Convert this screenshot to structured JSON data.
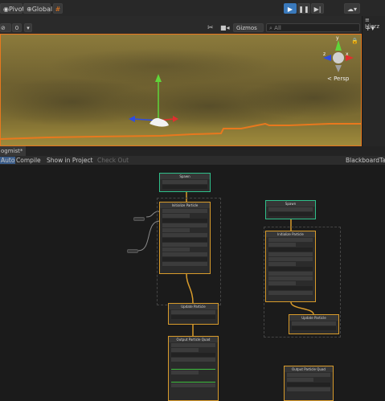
{
  "toolbar": {
    "pivot_label": "Pivot",
    "global_label": "Global",
    "play_icon": "play-icon",
    "pause_icon": "pause-icon",
    "step_icon": "step-icon"
  },
  "scene": {
    "gizmos_label": "Gizmos",
    "search_placeholder": "All",
    "persp_label": "< Persp",
    "axis_x": "x",
    "axis_y": "y",
    "axis_z": "z",
    "count_label": "0",
    "colors": {
      "selection_outline": "#e8781e",
      "sky": "#8a7a3a",
      "ground": "#7a6a2a"
    }
  },
  "hierarchy": {
    "tab_label": "Hierz"
  },
  "graph_tab": {
    "title": "ogmist*"
  },
  "graph_toolbar": {
    "auto_label": "Auto",
    "compile_label": "Compile",
    "show_in_project_label": "Show in Project",
    "check_out_label": "Check Out",
    "blackboard_label": "Blackboard",
    "tail_label": "Ta"
  },
  "nodes": {
    "spawn_a": "Spawn",
    "init_a": "Initialize Particle",
    "update_a": "Update Particle",
    "output_a": "Output Particle Quad",
    "spawn_b": "Spawn",
    "init_b": "Initialize Particle",
    "update_b": "Update Particle",
    "output_b": "Output Particle Quad"
  },
  "colors": {
    "context_green": "#2fbf8a",
    "context_orange": "#d89b2b",
    "wire": "#d89b2b",
    "graph_bg": "#1b1b1b"
  }
}
